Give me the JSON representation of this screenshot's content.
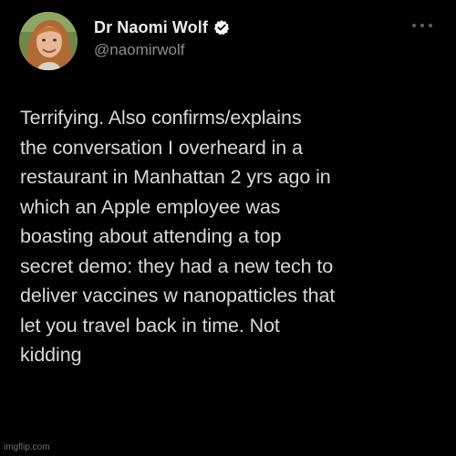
{
  "colors": {
    "background": "#000000",
    "text": "#d9d9d9",
    "display_name": "#ececec",
    "handle": "#8b8f94",
    "verified_badge": "#ffffff",
    "more_dots": "#5d6166"
  },
  "author": {
    "display_name": "Dr Naomi Wolf",
    "handle": "@naomirwolf",
    "verified": true,
    "avatar_icon": "profile-photo",
    "verified_icon": "verified-check-badge",
    "more_icon": "more-horizontal-dots"
  },
  "tweet": {
    "lines": [
      "Terrifying. Also confirms/explains",
      "the conversation I overheard in a",
      "restaurant in Manhattan 2 yrs ago in",
      "which an Apple employee was",
      "boasting about attending a top",
      "secret demo: they had a new tech to",
      "deliver vaccines w nanopatticles that",
      "let you travel back in time. Not",
      "kidding"
    ]
  },
  "watermark": "imgflip.com"
}
